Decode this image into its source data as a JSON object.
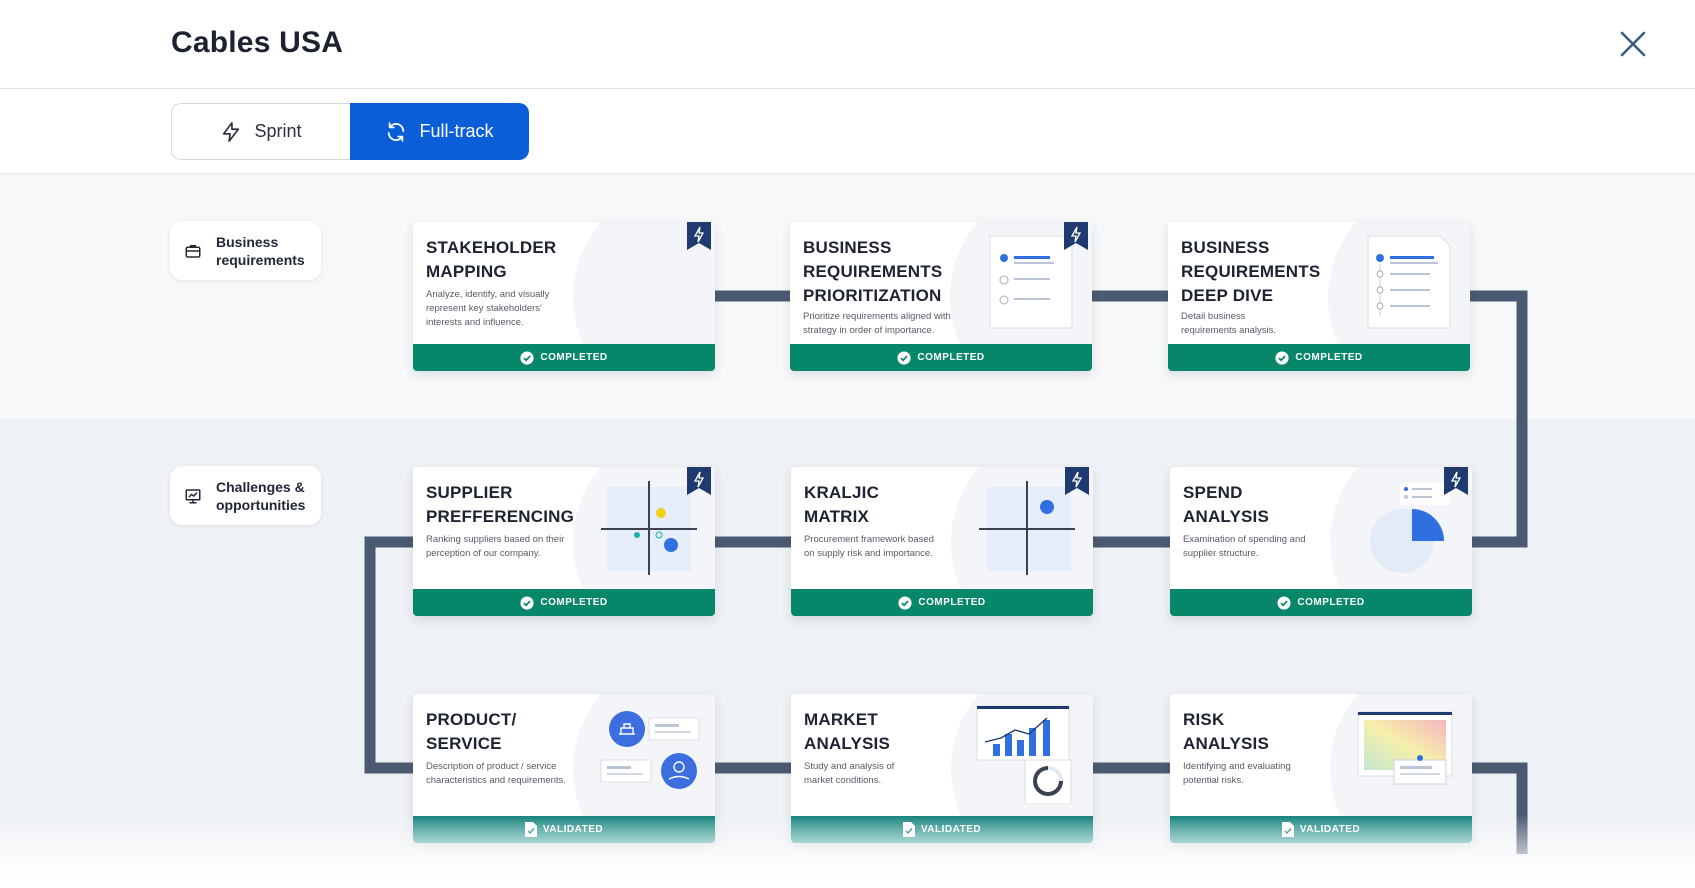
{
  "app": {
    "title": "Cables USA"
  },
  "modes": {
    "sprint_label": "Sprint",
    "fulltrack_label": "Full-track",
    "active": "Full-track"
  },
  "rows": [
    {
      "label": "Business\nrequirements"
    },
    {
      "label": "Challenges &\nopportunities"
    }
  ],
  "cards": [
    {
      "title": "STAKEHOLDER\nMAPPING",
      "desc": "Analyze, identify, and visually represent key stakeholders' interests and influence.",
      "status": "COMPLETED",
      "sprint": true
    },
    {
      "title": "BUSINESS\nREQUIREMENTS\nPRIORITIZATION",
      "desc": "Prioritize requirements aligned with strategy in order of importance.",
      "status": "COMPLETED",
      "sprint": true
    },
    {
      "title": "BUSINESS\nREQUIREMENTS\nDEEP DIVE",
      "desc": "Detail business requirements analysis.",
      "status": "COMPLETED",
      "sprint": false
    },
    {
      "title": "SUPPLIER\nPREFFERENCING",
      "desc": "Ranking suppliers based on their perception of our company.",
      "status": "COMPLETED",
      "sprint": true
    },
    {
      "title": "KRALJIC\nMATRIX",
      "desc": "Procurement framework based on supply risk and importance.",
      "status": "COMPLETED",
      "sprint": true
    },
    {
      "title": "SPEND\nANALYSIS",
      "desc": "Examination of spending and supplier structure.",
      "status": "COMPLETED",
      "sprint": true
    },
    {
      "title": "PRODUCT/\nSERVICE",
      "desc": "Description of product / service characteristics and requirements.",
      "status": "VALIDATED",
      "sprint": false
    },
    {
      "title": "MARKET\nANALYSIS",
      "desc": "Study and analysis of market conditions.",
      "status": "VALIDATED",
      "sprint": false
    },
    {
      "title": "RISK\nANALYSIS",
      "desc": "Identifying and evaluating potential risks.",
      "status": "VALIDATED",
      "sprint": false
    }
  ],
  "icons": {
    "close": "close-icon",
    "sprint": "lightning-icon",
    "fulltrack": "refresh-icon",
    "row_business": "briefcase-icon",
    "row_challenges": "presentation-chart-icon",
    "completed": "check-circle-icon",
    "validated": "document-check-icon",
    "sprint_flag": "sprint-bookmark-icon"
  },
  "colors": {
    "accent": "#0a5ed7",
    "completed": "#07876a",
    "validated": "#0f7f78",
    "connector": "#4b5a72",
    "flag": "#1e3a6e"
  }
}
